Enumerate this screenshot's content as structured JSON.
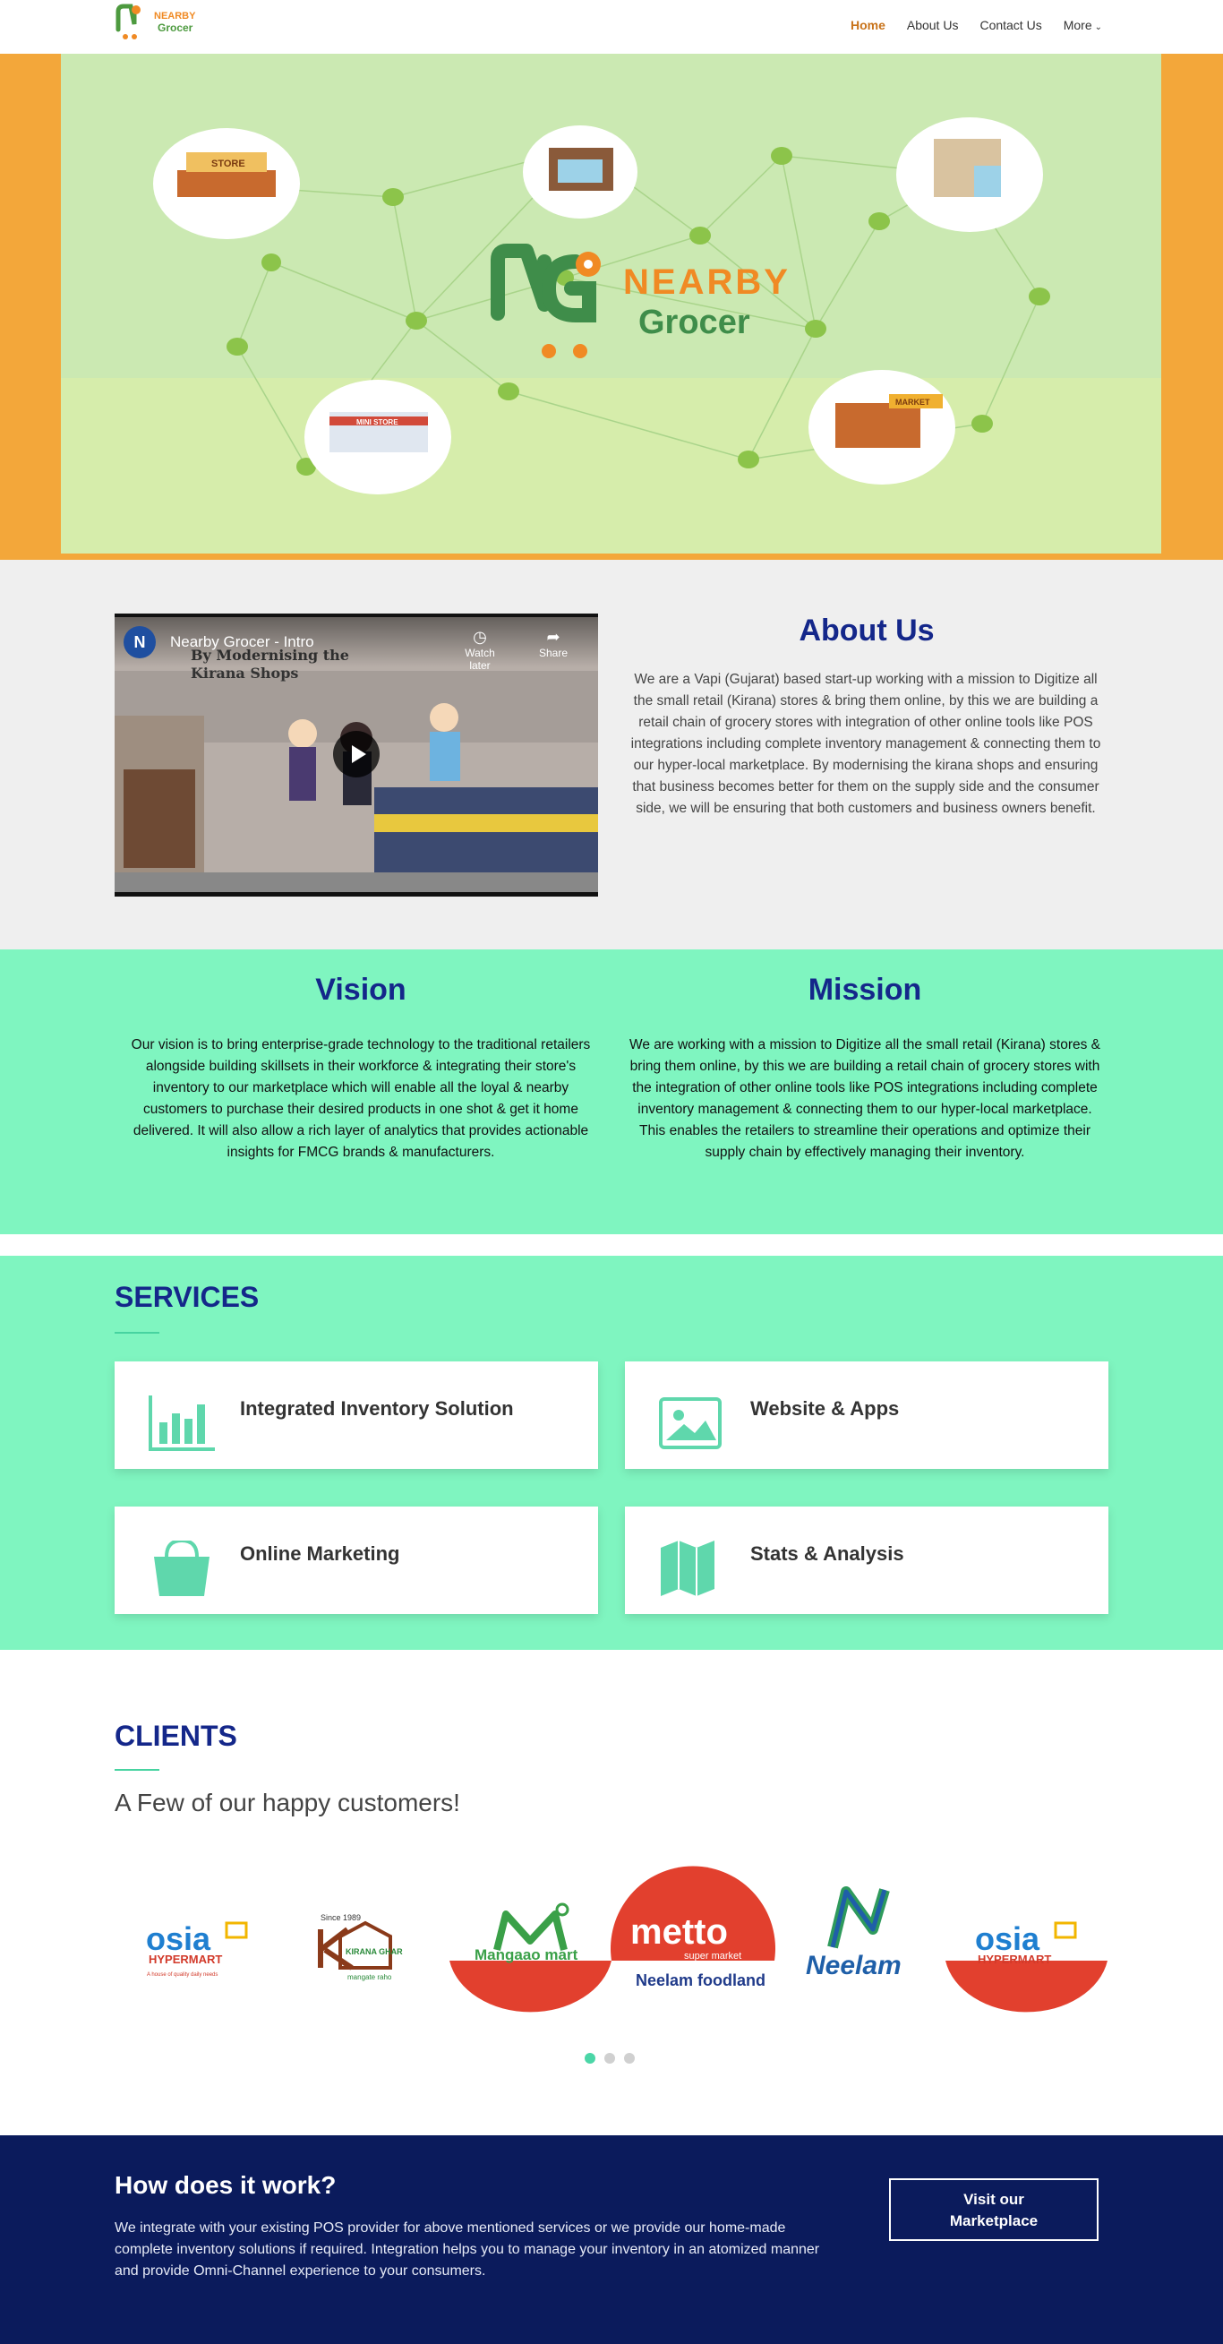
{
  "brand": {
    "name_top": "NEARBY",
    "name_bottom": "Grocer",
    "accent": "#c8731a",
    "navy": "#14278a",
    "mint": "#7ff5c0"
  },
  "nav": {
    "items": [
      {
        "label": "Home",
        "active": true
      },
      {
        "label": "About Us"
      },
      {
        "label": "Contact Us"
      },
      {
        "label": "More",
        "has_dropdown": true
      }
    ]
  },
  "hero": {
    "store_signs": [
      "STORE",
      "MINI STORE",
      "MARKET"
    ],
    "logo_top": "NEARBY",
    "logo_bottom": "Grocer"
  },
  "about": {
    "video": {
      "title": "Nearby Grocer - Intro",
      "channel_initial": "N",
      "watch_later": "Watch later",
      "share": "Share",
      "caption": "By Modernising the Kirana Shops"
    },
    "title": "About Us",
    "text": "We are a Vapi (Gujarat) based start-up working with a mission to Digitize all the small retail (Kirana) stores & bring them online, by this we are building a retail chain of grocery stores with integration of other online tools like POS integrations including complete inventory management & connecting them to our hyper-local marketplace. By modernising the kirana shops and ensuring that business becomes better for them on the supply side and the consumer side, we will be ensuring that both customers and business owners benefit."
  },
  "vision": {
    "title": "Vision",
    "text": "Our vision is to bring enterprise-grade technology to the traditional retailers alongside building skillsets in their workforce & integrating their store's inventory to our marketplace which will enable all the loyal & nearby customers to purchase their desired products in one shot & get it home delivered. It will also allow a rich layer of analytics that provides actionable insights for FMCG brands & manufacturers."
  },
  "mission": {
    "title": "Mission",
    "text": "We are working with a mission to Digitize all the small retail (Kirana) stores & bring them online, by this we are building a retail chain of grocery stores with the integration of other online tools like POS integrations including complete inventory management & connecting them to our hyper-local marketplace. This enables the retailers to streamline their operations and optimize their supply chain by effectively managing their inventory."
  },
  "services": {
    "title": "SERVICES",
    "cards": [
      {
        "label": "Integrated Inventory Solution",
        "icon": "bar-chart-icon"
      },
      {
        "label": "Website & Apps",
        "icon": "image-icon"
      },
      {
        "label": "Online Marketing",
        "icon": "shopping-bag-icon"
      },
      {
        "label": "Stats & Analysis",
        "icon": "map-icon"
      }
    ]
  },
  "clients": {
    "title": "CLIENTS",
    "subtitle": "A Few of our happy customers!",
    "logos": [
      {
        "name": "osia",
        "sub": "HYPERMART",
        "tag": "A house of quality daily needs"
      },
      {
        "name": "KIRANA GHAR",
        "sub": "Since 1989",
        "tag": "mangate raho"
      },
      {
        "name": "Mangaao mart"
      },
      {
        "name": "metto",
        "sub": "super market",
        "tag": "Neelam foodland"
      },
      {
        "name": "Neelam"
      },
      {
        "name": "osia",
        "sub": "HYPERMART"
      }
    ],
    "active_page": 1,
    "page_count": 3
  },
  "cta": {
    "title": "How does it work?",
    "text": "We integrate with your existing POS provider for above mentioned services or we provide our home-made complete inventory solutions if required. Integration helps you to manage your inventory in an atomized manner and provide Omni-Channel experience to your consumers.",
    "button_line1": "Visit our",
    "button_line2": "Marketplace"
  }
}
